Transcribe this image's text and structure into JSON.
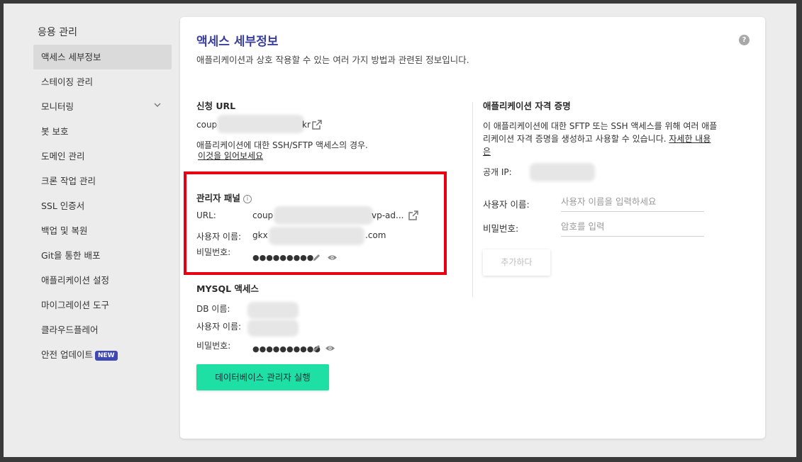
{
  "sidebar": {
    "title": "응용 관리",
    "items": [
      {
        "label": "액세스 세부정보"
      },
      {
        "label": "스테이징 관리"
      },
      {
        "label": "모니터링"
      },
      {
        "label": "봇 보호"
      },
      {
        "label": "도메인 관리"
      },
      {
        "label": "크론 작업 관리"
      },
      {
        "label": "SSL 인증서"
      },
      {
        "label": "백업 및 복원"
      },
      {
        "label": "Git을 통한 배포"
      },
      {
        "label": "애플리케이션 설정"
      },
      {
        "label": "마이그레이션 도구"
      },
      {
        "label": "클라우드플레어"
      },
      {
        "label": "안전 업데이트"
      }
    ],
    "new_badge": "NEW"
  },
  "card": {
    "title": "액세스 세부정보",
    "subtitle": "애플리케이션과 상호 작용할 수 있는 여러 가지 방법과 관련된 정보입니다.",
    "help": "?"
  },
  "app_url": {
    "heading": "신청 URL",
    "value_start": "coup",
    "value_end": "kr",
    "note": "애플리케이션에 대한 SSH/SFTP 액세스의 경우.",
    "link": "이것을 읽어보세요"
  },
  "admin": {
    "heading": "관리자 패널",
    "info": "i",
    "url_label": "URL:",
    "url_start": "coup",
    "url_end": "vp-ad...",
    "user_label": "사용자 이름:",
    "user_start": "gkx",
    "user_end": ".com",
    "pass_label": "비밀번호:",
    "pass_dots": "●●●●●●●●●"
  },
  "mysql": {
    "heading": "MYSQL 액세스",
    "db_label": "DB 이름:",
    "user_label": "사용자 이름:",
    "pass_label": "비밀번호:",
    "pass_dots": "●●●●●●●●●●"
  },
  "db_button": "데이터베이스 관리자 실행",
  "credentials": {
    "heading": "애플리케이션 자격 증명",
    "desc_line1": "이 애플리케이션에 대한 SFTP 또는 SSH 액세스를 위해 여러 애플",
    "desc_line2": "리케이션 자격 증명을 생성하고 사용할 수 있습니다.",
    "more_link_1": "자세한 내용",
    "more_link_2": "은",
    "ip_label": "공개 IP:",
    "username_label": "사용자 이름:",
    "username_placeholder": "사용자 이름을 입력하세요",
    "password_label": "비밀번호:",
    "password_placeholder": "암호를 입력",
    "add_button": "추가하다"
  },
  "colors": {
    "accent": "#3a3f9e",
    "button": "#1fe0a4",
    "highlight": "#e60012",
    "badge": "#3f47b5"
  }
}
